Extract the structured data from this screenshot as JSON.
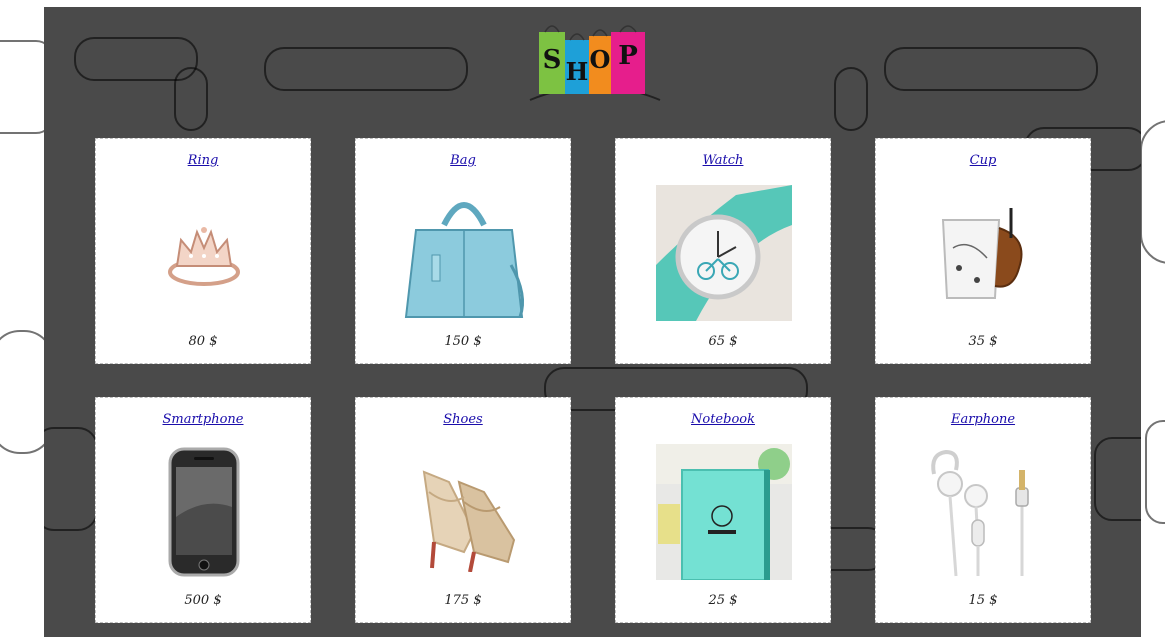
{
  "header": {
    "logo_text": "SHOP"
  },
  "products": [
    {
      "name": "Ring",
      "price": "80 $",
      "icon": "ring-icon"
    },
    {
      "name": "Bag",
      "price": "150 $",
      "icon": "bag-icon"
    },
    {
      "name": "Watch",
      "price": "65 $",
      "icon": "watch-icon"
    },
    {
      "name": "Cup",
      "price": "35 $",
      "icon": "cup-icon"
    },
    {
      "name": "Smartphone",
      "price": "500 $",
      "icon": "smartphone-icon"
    },
    {
      "name": "Shoes",
      "price": "175 $",
      "icon": "shoes-icon"
    },
    {
      "name": "Notebook",
      "price": "25 $",
      "icon": "notebook-icon"
    },
    {
      "name": "Earphone",
      "price": "15 $",
      "icon": "earphone-icon"
    }
  ],
  "colors": {
    "link": "#1a0dab",
    "panel": "#4a4a4a",
    "logo_green": "#7dc242",
    "logo_blue": "#1ea0d8",
    "logo_orange": "#f28c1e",
    "logo_pink": "#e61e8c"
  }
}
